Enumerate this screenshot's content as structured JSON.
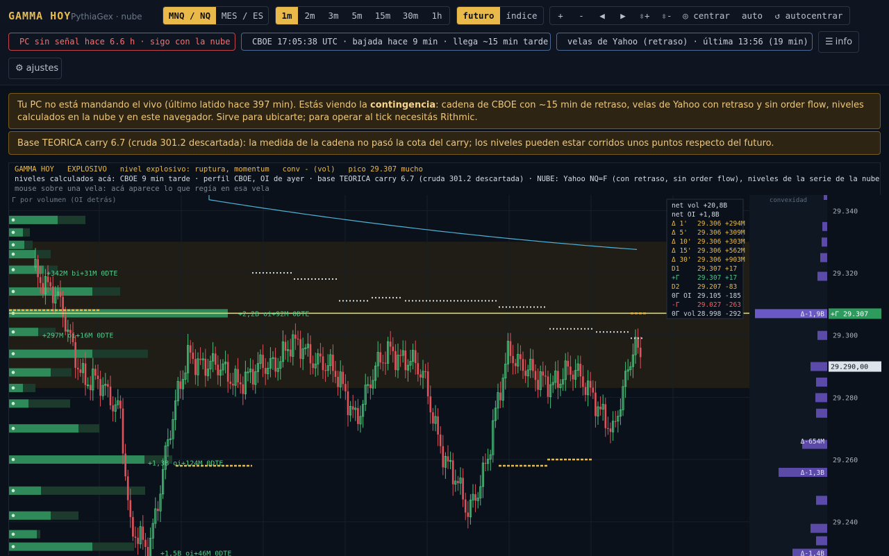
{
  "header": {
    "brand": "GAMMA HOY",
    "sub": "PythiaGex · nube",
    "instruments": [
      "MNQ / NQ",
      "MES / ES"
    ],
    "timeframes": [
      "1m",
      "2m",
      "3m",
      "5m",
      "15m",
      "30m",
      "1h"
    ],
    "source_modes": [
      "futuro",
      "índice"
    ],
    "view_controls": [
      "+",
      "-",
      "◀",
      "▶",
      "⇳+",
      "⇳-",
      "◎ centrar",
      "auto",
      "↺ autocentrar"
    ],
    "status_pc": "PC sin señal hace 6.6 h · sigo con la nube",
    "status_cboe": "CBOE 17:05:38 UTC · bajada hace 9 min · llega ~15 min tarde",
    "status_candles": "velas de Yahoo (retraso) · última 13:56 (19 min)",
    "info_label": "info",
    "settings_label": "ajustes",
    "colors": {
      "accent": "#e9b949",
      "alert": "#ff6b6b",
      "status_dot": "#7fb2ff"
    }
  },
  "banners": {
    "contingency_before": "Tu PC no está mandando el vivo (último latido hace 397 min). Estás viendo la ",
    "contingency_bold": "contingencia",
    "contingency_after": ": cadena de CBOE con ~15 min de retraso, velas de Yahoo con retraso y sin order flow, niveles calculados en la nube y en este navegador. Sirve para ubicarte; para operar al tick necesitás Rithmic.",
    "carry": "Base TEORICA carry 6.7 (cruda 301.2 descartada): la medida de la cadena no pasó la cota del carry; los niveles pueden estar corridos unos puntos respecto del futuro."
  },
  "chart_info": {
    "title": "GAMMA HOY",
    "regime": "EXPLOSIVO",
    "regime_desc": "nivel explosivo: ruptura, momentum",
    "conv": "conv - (vol)",
    "peak": "pico 29.307 mucho",
    "line2": "niveles calculados acá: CBOE 9 min tarde · perfil CBOE, OI de ayer · base TEORICA carry 6.7 (cruda 301.2 descartada) · NUBE: Yahoo NQ=F (con retraso, sin order flow), niveles de la serie de la nube",
    "hover_hint": "mouse sobre una vela: acá aparece lo que regía en esa vela",
    "gex_label": "Γ por volumen (OI detrás)",
    "convexity_label": "convexidad"
  },
  "chart_data": {
    "type": "candlestick",
    "y_axis": {
      "range": [
        29229,
        29345
      ],
      "ticks": [
        "29.340",
        "29.320",
        "29.300",
        "29.280",
        "29.260",
        "29.240"
      ]
    },
    "price_tag": "29.290,00",
    "key_level": {
      "label": "+Γ 29.307",
      "value": 29307,
      "delta_label": "Δ-1,9B"
    },
    "level_labels": [
      {
        "text": "+342M bi+31M 0DTE",
        "value": 29320
      },
      {
        "text": "+2,2B oi+92M 0DTE",
        "value": 29307
      },
      {
        "text": "+297M oi+16M 0DTE",
        "value": 29300
      },
      {
        "text": "+1,3B oi+124M 0DTE",
        "value": 29259
      },
      {
        "text": "+1,5B oi+46M 0DTE",
        "value": 29230
      }
    ],
    "convexity_labels": [
      {
        "text": "Δ-654M",
        "value": 29266
      },
      {
        "text": "Δ-1,3B",
        "value": 29256
      },
      {
        "text": "Δ-1,4B",
        "value": 29230
      }
    ],
    "zone": {
      "from": 29283,
      "to": 29330
    },
    "panel": {
      "net_vol": "net vol +20,8B",
      "net_oi": "net OI  +1,8B",
      "rows": [
        {
          "k": "Δ  1'",
          "v": "29.306 +294M",
          "color": "#e9b949"
        },
        {
          "k": "Δ  5'",
          "v": "29.306 +309M",
          "color": "#e9b949"
        },
        {
          "k": "Δ 10'",
          "v": "29.306 +303M",
          "color": "#e9b949"
        },
        {
          "k": "Δ 15'",
          "v": "29.306 +562M",
          "color": "#e9b949"
        },
        {
          "k": "Δ 30'",
          "v": "29.306 +903M",
          "color": "#e9b949"
        },
        {
          "k": "D1",
          "v": "29.307 +17",
          "color": "#e9b949"
        },
        {
          "k": "+Γ",
          "v": "29.307 +17",
          "color": "#4cc38a"
        },
        {
          "k": "D2",
          "v": "29.207 -83",
          "color": "#e9b949"
        },
        {
          "k": "0Γ OI",
          "v": "29.105 -185",
          "color": "#c9d1d9"
        },
        {
          "k": "-Γ",
          "v": "29.027 -263",
          "color": "#ff5f5f"
        },
        {
          "k": "0Γ vol",
          "v": "28.998 -292",
          "color": "#c9d1d9"
        }
      ]
    }
  }
}
